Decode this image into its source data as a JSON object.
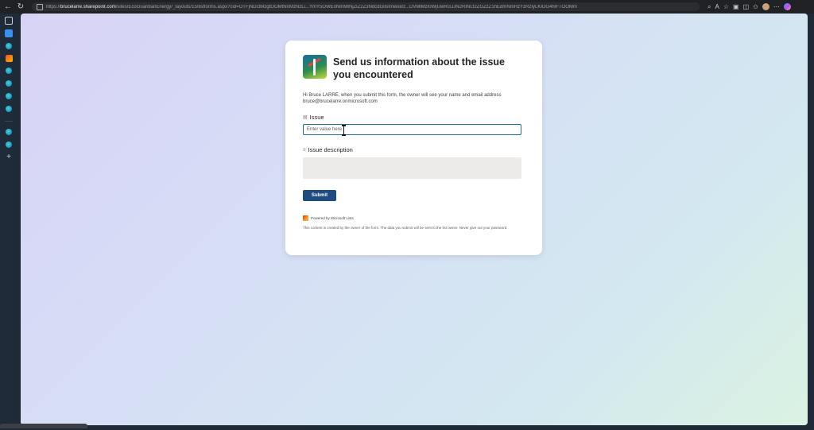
{
  "browser": {
    "url_prefix": "https://",
    "url_host": "brucelarre.sharepoint.com",
    "url_path": "/sites/EcoGuardianEnergy/_layouts/15/listforms.aspx?cid=OTFjNDctMzgtOOMtN0MzNzLi...YmY5OWE0NmMtNjZlZ2Z3NdcdGiIsImwioiIz...DVMlMzI0WjUwRGJJN2RINLf2ZGZzZ1hEdmNmHzYzRzIyLKIDG4hIFTOOMm"
  },
  "form": {
    "title": "Send us information about the issue you encountered",
    "intro": "Hi Bruce LARRE, when you submit this form, the owner will see your name and email address bruce@brucelarre.onmicrosoft.com",
    "issue_label": "Issue",
    "issue_placeholder": "Enter value here",
    "description_label": "Issue description",
    "submit_label": "Submit",
    "powered_by": "Powered by Microsoft Lists",
    "disclaimer": "This content is created by the owner of the form. The data you submit will be sent to the list owner. Never give out your password."
  },
  "icons": {
    "issue_field_icon": "text-field-icon",
    "description_field_icon": "multiline-text-icon"
  },
  "colors": {
    "submit_bg": "#1e4b82",
    "input_border": "#1f6ea0"
  }
}
